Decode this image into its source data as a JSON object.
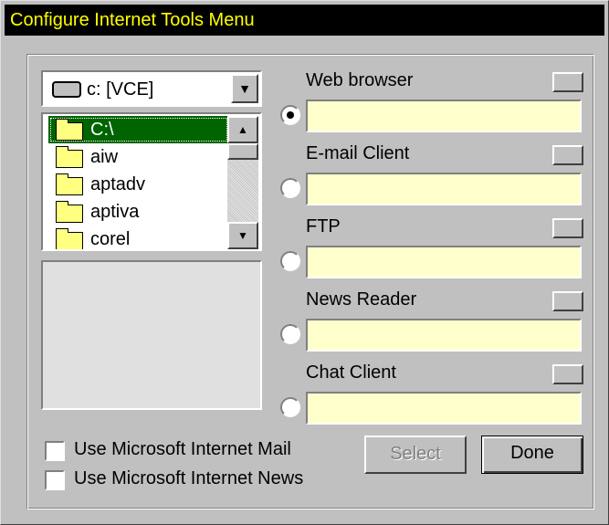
{
  "window": {
    "title": "Configure Internet Tools Menu"
  },
  "drive": {
    "label": "c: [VCE]",
    "icon": "drive-icon"
  },
  "folders": [
    {
      "label": "C:\\",
      "selected": true,
      "icon": "open-folder-icon"
    },
    {
      "label": "aiw",
      "selected": false,
      "icon": "folder-icon"
    },
    {
      "label": "aptadv",
      "selected": false,
      "icon": "folder-icon"
    },
    {
      "label": "aptiva",
      "selected": false,
      "icon": "folder-icon"
    },
    {
      "label": "corel",
      "selected": false,
      "icon": "folder-icon"
    }
  ],
  "tools": [
    {
      "label": "Web browser",
      "selected": true,
      "value": ""
    },
    {
      "label": "E-mail Client",
      "selected": false,
      "value": ""
    },
    {
      "label": "FTP",
      "selected": false,
      "value": ""
    },
    {
      "label": "News Reader",
      "selected": false,
      "value": ""
    },
    {
      "label": "Chat Client",
      "selected": false,
      "value": ""
    }
  ],
  "options": {
    "use_ms_mail": "Use Microsoft Internet Mail",
    "use_ms_news": "Use Microsoft Internet News"
  },
  "buttons": {
    "select": "Select",
    "done": "Done"
  },
  "colors": {
    "title_bg": "#000000",
    "title_text": "#ffff00",
    "input_bg": "#ffffcc",
    "selection": "#006400"
  }
}
